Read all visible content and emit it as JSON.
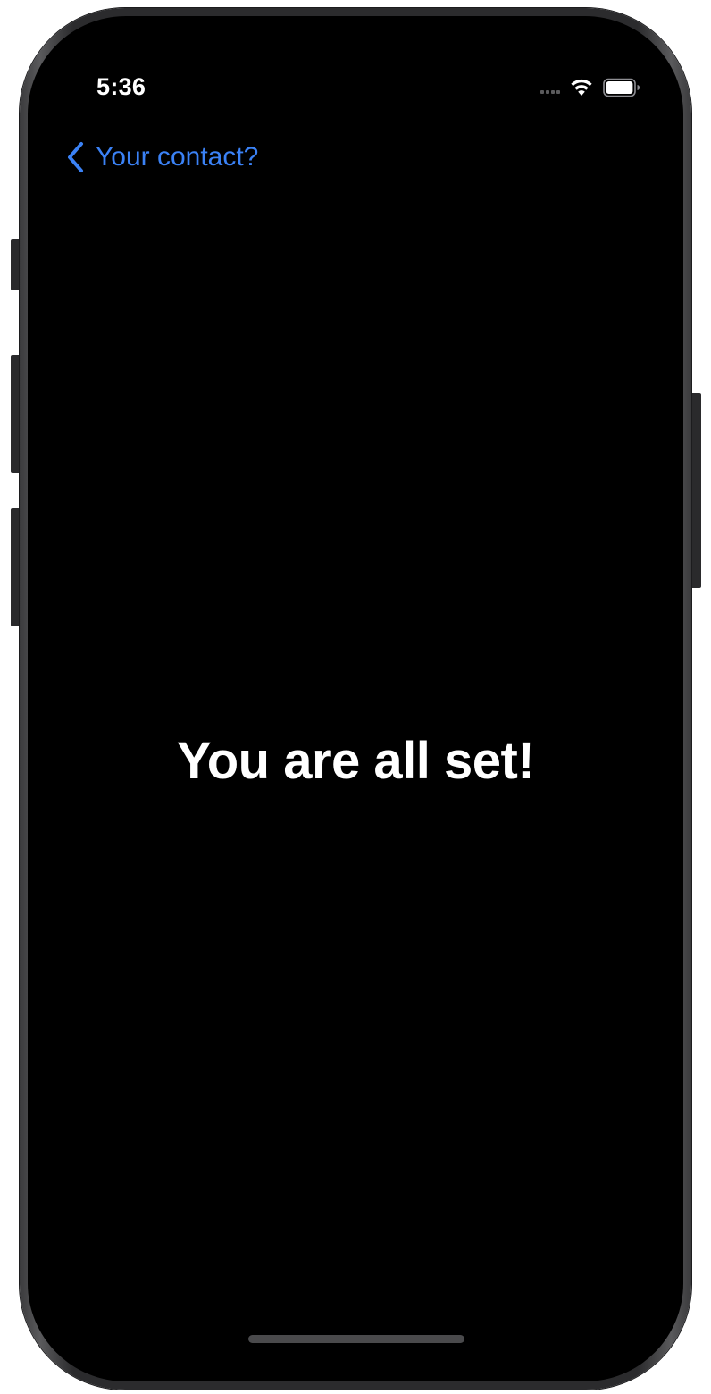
{
  "status_bar": {
    "time": "5:36",
    "icons": [
      "cellular-signal-icon",
      "wifi-icon",
      "battery-icon"
    ]
  },
  "nav": {
    "back_label": "Your contact?",
    "back_icon": "chevron-left-icon"
  },
  "main": {
    "headline": "You are all set!"
  },
  "colors": {
    "background": "#000000",
    "accent": "#3b82f6",
    "text": "#ffffff"
  }
}
